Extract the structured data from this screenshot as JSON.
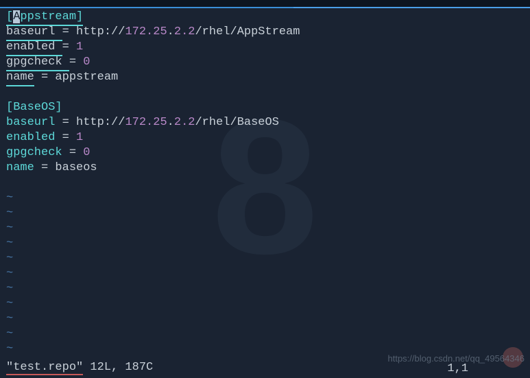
{
  "repo1": {
    "section_open": "[",
    "section_name": "Appstream",
    "section_close": "]",
    "baseurl_key": "baseurl",
    "baseurl_proto": "http://",
    "baseurl_ip": "172.25",
    "baseurl_ip2": ".2.2",
    "baseurl_path": "/rhel/AppStream",
    "enabled_key": "enabled",
    "enabled_val": "1",
    "gpgcheck_key": "gpgcheck",
    "gpgcheck_val": "0",
    "name_key": "name",
    "name_val": "appstream"
  },
  "repo2": {
    "section": "[BaseOS]",
    "baseurl_key": "baseurl",
    "baseurl_proto": "http://",
    "baseurl_ip": "172.25",
    "baseurl_ip2": ".2.2",
    "baseurl_path": "/rhel/BaseOS",
    "enabled_key": "enabled",
    "enabled_val": "1",
    "gpgcheck_key": "gpgcheck",
    "gpgcheck_val": "0",
    "name_key": "name",
    "name_val": "baseos"
  },
  "eq": " = ",
  "dot": ".",
  "tilde": "~",
  "status": {
    "filename": "\"test.repo\"",
    "info": " 12L, 187C",
    "position": "1,1"
  },
  "watermark": "https://blog.csdn.net/qq_49564346",
  "bg_mark": "8"
}
